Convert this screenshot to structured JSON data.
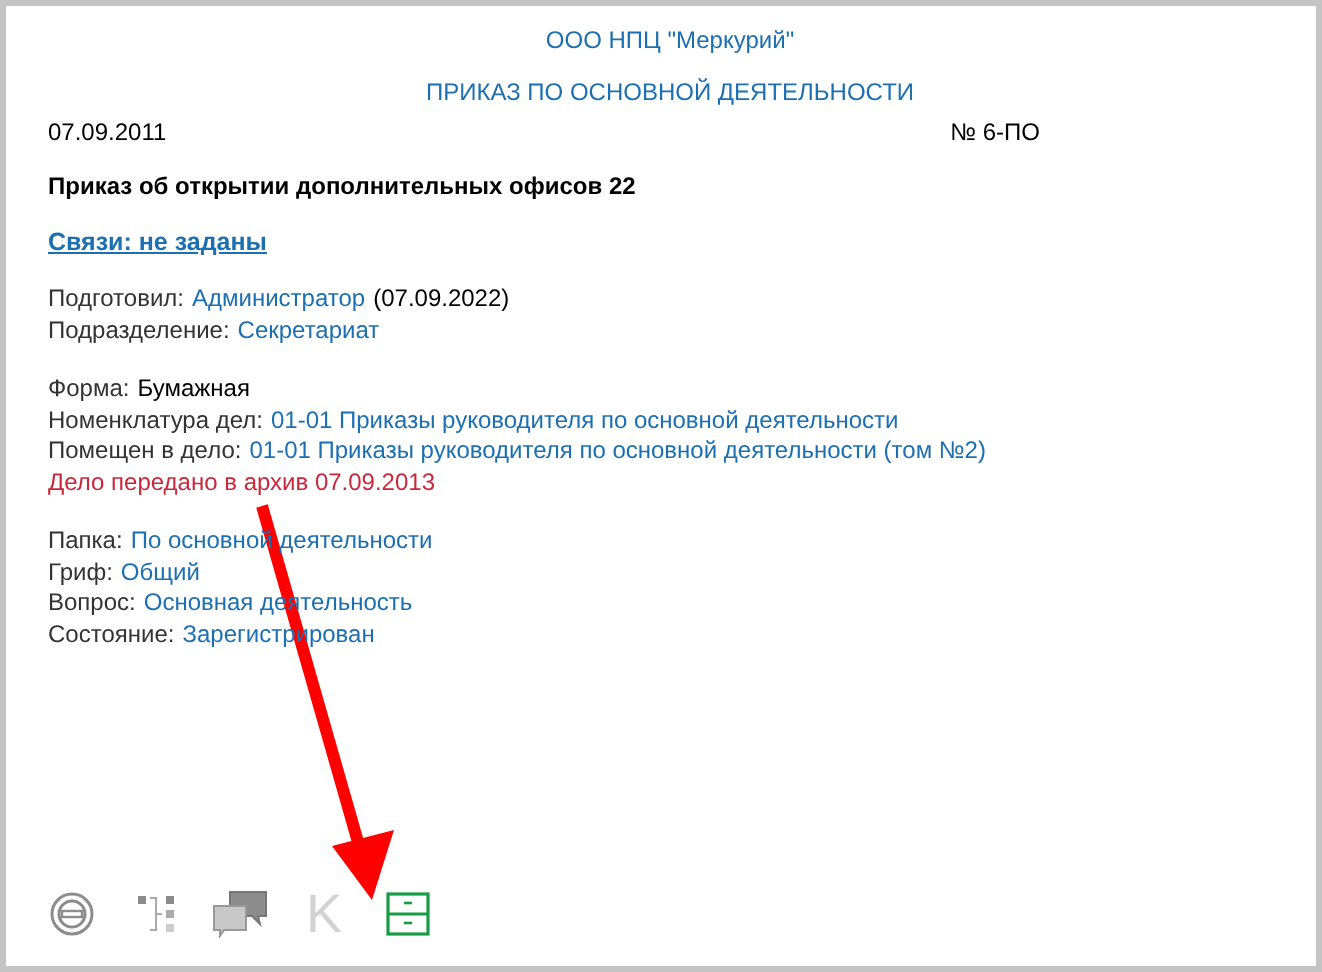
{
  "header": {
    "organization": "ООО НПЦ \"Меркурий\"",
    "document_type": "ПРИКАЗ ПО ОСНОВНОЙ ДЕЯТЕЛЬНОСТИ",
    "date": "07.09.2011",
    "number": "№ 6-ПО"
  },
  "title": "Приказ об открытии дополнительных офисов 22",
  "links_text": "Связи: не заданы",
  "groups": [
    [
      {
        "kind": "field",
        "label": "Подготовил:",
        "value": "Администратор",
        "note": "(07.09.2022)"
      },
      {
        "kind": "field",
        "label": "Подразделение:",
        "value": "Секретариат"
      }
    ],
    [
      {
        "kind": "plain",
        "label": "Форма:",
        "value": "Бумажная"
      },
      {
        "kind": "field",
        "label": "Номенклатура дел:",
        "value": "01-01 Приказы руководителя по основной деятельности"
      },
      {
        "kind": "field",
        "label": "Помещен в дело:",
        "value": "01-01 Приказы руководителя по основной деятельности (том №2)"
      },
      {
        "kind": "notice",
        "value": "Дело передано в архив 07.09.2013"
      }
    ],
    [
      {
        "kind": "field",
        "label": "Папка:",
        "value": "По основной деятельности"
      },
      {
        "kind": "field",
        "label": "Гриф:",
        "value": "Общий"
      },
      {
        "kind": "field",
        "label": "Вопрос:",
        "value": "Основная деятельность"
      },
      {
        "kind": "field",
        "label": "Состояние:",
        "value": "Зарегистрирован"
      }
    ]
  ],
  "toolbar": [
    {
      "kind": "circle",
      "active": false
    },
    {
      "kind": "tree",
      "active": false
    },
    {
      "kind": "chat",
      "active": false
    },
    {
      "kind": "letter",
      "label": "K",
      "active": false
    },
    {
      "kind": "archive",
      "active": true
    }
  ],
  "annotation": {
    "kind": "arrow"
  }
}
